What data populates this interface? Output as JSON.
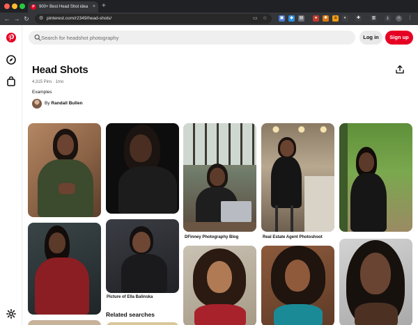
{
  "browser": {
    "tab_title": "900+ Best Head Shot ideas",
    "tab_close": "×",
    "new_tab": "+",
    "url": "pinterest.com/r2349/head-shots/"
  },
  "search": {
    "placeholder": "Search for headshot photography"
  },
  "header": {
    "login_label": "Log in",
    "signup_label": "Sign up"
  },
  "board": {
    "title": "Head Shots",
    "meta": "4,315 Pins · 1mo",
    "description": "Examples",
    "author_prefix": "By",
    "author_name": "Randall Bullen"
  },
  "pins": {
    "caption_3": "DFinney Photography Blog",
    "caption_4": "Real Estate Agent Photoshoot",
    "caption_7": "Picture of Ella Balinska"
  },
  "related": {
    "title": "Related searches"
  },
  "colors": {
    "brand": "#e60023",
    "text": "#111111"
  }
}
